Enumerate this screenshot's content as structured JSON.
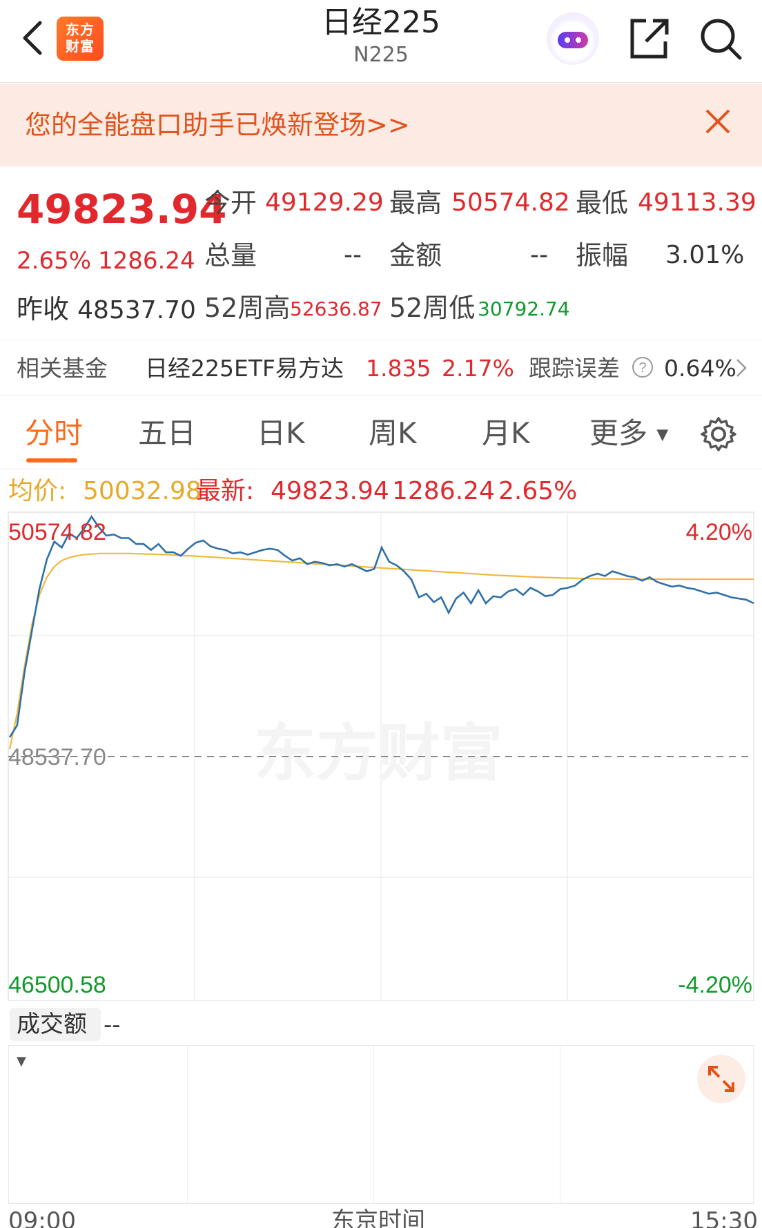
{
  "header": {
    "title": "日经225",
    "subtitle": "N225",
    "logo_text": "东方财富",
    "icons": [
      "back-arrow-icon",
      "robot-assistant-icon",
      "share-icon",
      "search-icon"
    ]
  },
  "banner": {
    "text": "您的全能盘口助手已焕新登场>>"
  },
  "quote": {
    "price": "49823.94",
    "change_pct": "2.65%",
    "change": "1286.24",
    "prev_close_label": "昨收",
    "prev_close": "48537.70",
    "open_label": "今开",
    "open": "49129.29",
    "high_label": "最高",
    "high": "50574.82",
    "low_label": "最低",
    "low": "49113.39",
    "volume_label": "总量",
    "volume": "--",
    "amount_label": "金额",
    "amount": "--",
    "amplitude_label": "振幅",
    "amplitude": "3.01%",
    "wk52_high_label": "52周高",
    "wk52_high": "52636.87",
    "wk52_low_label": "52周低",
    "wk52_low": "30792.74"
  },
  "fund": {
    "label": "相关基金",
    "name": "日经225ETF易方达",
    "price": "1.835",
    "pct": "2.17%",
    "tracking_label": "跟踪误差",
    "tracking": "0.64%"
  },
  "tabs": [
    "分时",
    "五日",
    "日K",
    "周K",
    "月K",
    "更多"
  ],
  "avg_row": {
    "avg_label": "均价:",
    "avg_value": "50032.98",
    "latest_label": "最新:",
    "latest_value": "49823.94",
    "latest_change": "1286.24",
    "latest_pct": "2.65%"
  },
  "chart_labels": {
    "top_left": "50574.82",
    "top_right": "4.20%",
    "mid_left": "48537.70",
    "bottom_left": "46500.58",
    "bottom_right": "-4.20%",
    "watermark": "东方财富"
  },
  "volume": {
    "selector": "成交额",
    "value": "--"
  },
  "time_axis": {
    "start": "09:00",
    "middle": "东京时间",
    "end": "15:30"
  },
  "colors": {
    "up": "#e0282d",
    "down": "#119a2b",
    "accent": "#ff6a1a",
    "price_line": "#2f6fa8",
    "avg_line": "#f2b83d"
  },
  "chart_data": {
    "type": "line",
    "ylim": [
      46500.58,
      50574.82
    ],
    "base": 48537.7,
    "series": [
      {
        "name": "最新",
        "values": [
          48700,
          48800,
          49250,
          49600,
          49950,
          50200,
          50350,
          50300,
          50420,
          50380,
          50460,
          50560,
          50470,
          50400,
          50410,
          50380,
          50380,
          50330,
          50330,
          50280,
          50330,
          50260,
          50260,
          50230,
          50290,
          50340,
          50360,
          50310,
          50290,
          50280,
          50250,
          50260,
          50240,
          50260,
          50280,
          50290,
          50280,
          50230,
          50190,
          50210,
          50160,
          50180,
          50170,
          50150,
          50160,
          50140,
          50160,
          50130,
          50100,
          50120,
          50300,
          50180,
          50150,
          50100,
          50030,
          49880,
          49910,
          49840,
          49880,
          49750,
          49870,
          49920,
          49830,
          49940,
          49830,
          49890,
          49880,
          49930,
          49950,
          49900,
          49960,
          49930,
          49890,
          49900,
          49950,
          49960,
          49980,
          50030,
          50060,
          50080,
          50060,
          50100,
          50080,
          50060,
          50050,
          50020,
          50050,
          50010,
          49990,
          49970,
          49980,
          49960,
          49950,
          49930,
          49910,
          49920,
          49900,
          49880,
          49870,
          49860,
          49830
        ]
      },
      {
        "name": "均价",
        "values": [
          48600,
          48900,
          49300,
          49650,
          49900,
          50050,
          50140,
          50190,
          50215,
          50230,
          50240,
          50245,
          50250,
          50250,
          50250,
          50250,
          50250,
          50248,
          50246,
          50244,
          50242,
          50240,
          50237,
          50234,
          50231,
          50228,
          50224,
          50220,
          50216,
          50212,
          50208,
          50204,
          50200,
          50196,
          50192,
          50188,
          50184,
          50180,
          50176,
          50172,
          50168,
          50164,
          50160,
          50156,
          50152,
          50148,
          50144,
          50140,
          50136,
          50132,
          50128,
          50124,
          50120,
          50116,
          50112,
          50108,
          50104,
          50100,
          50096,
          50092,
          50088,
          50084,
          50080,
          50076,
          50072,
          50068,
          50065,
          50062,
          50059,
          50056,
          50053,
          50050,
          50048,
          50046,
          50044,
          50042,
          50040,
          50039,
          50038,
          50037,
          50036,
          50035,
          50034,
          50033,
          50033,
          50033,
          50033,
          50033,
          50033,
          50033,
          50033,
          50033,
          50033,
          50033,
          50033,
          50033,
          50033,
          50033,
          50033,
          50033,
          50033
        ]
      }
    ],
    "grid": true
  }
}
